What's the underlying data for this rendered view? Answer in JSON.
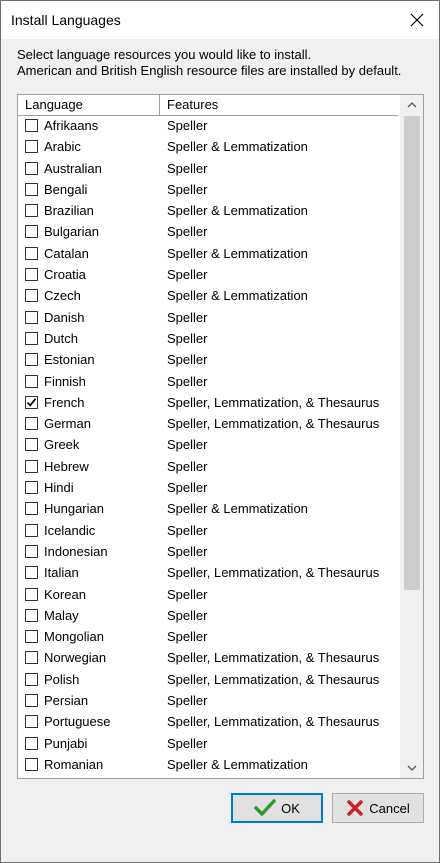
{
  "window": {
    "title": "Install Languages"
  },
  "intro": {
    "line1": "Select language resources you would like to install.",
    "line2": "American and British English resource files are installed by default."
  },
  "columns": [
    "Language",
    "Features"
  ],
  "rows": [
    {
      "language": "Afrikaans",
      "features": "Speller",
      "checked": false
    },
    {
      "language": "Arabic",
      "features": "Speller & Lemmatization",
      "checked": false
    },
    {
      "language": "Australian",
      "features": "Speller",
      "checked": false
    },
    {
      "language": "Bengali",
      "features": "Speller",
      "checked": false
    },
    {
      "language": "Brazilian",
      "features": "Speller & Lemmatization",
      "checked": false
    },
    {
      "language": "Bulgarian",
      "features": "Speller",
      "checked": false
    },
    {
      "language": "Catalan",
      "features": "Speller & Lemmatization",
      "checked": false
    },
    {
      "language": "Croatia",
      "features": "Speller",
      "checked": false
    },
    {
      "language": "Czech",
      "features": "Speller & Lemmatization",
      "checked": false
    },
    {
      "language": "Danish",
      "features": "Speller",
      "checked": false
    },
    {
      "language": "Dutch",
      "features": "Speller",
      "checked": false
    },
    {
      "language": "Estonian",
      "features": "Speller",
      "checked": false
    },
    {
      "language": "Finnish",
      "features": "Speller",
      "checked": false
    },
    {
      "language": "French",
      "features": "Speller, Lemmatization, & Thesaurus",
      "checked": true
    },
    {
      "language": "German",
      "features": "Speller, Lemmatization, & Thesaurus",
      "checked": false
    },
    {
      "language": "Greek",
      "features": "Speller",
      "checked": false
    },
    {
      "language": "Hebrew",
      "features": "Speller",
      "checked": false
    },
    {
      "language": "Hindi",
      "features": "Speller",
      "checked": false
    },
    {
      "language": "Hungarian",
      "features": "Speller & Lemmatization",
      "checked": false
    },
    {
      "language": "Icelandic",
      "features": "Speller",
      "checked": false
    },
    {
      "language": "Indonesian",
      "features": "Speller",
      "checked": false
    },
    {
      "language": "Italian",
      "features": "Speller, Lemmatization, & Thesaurus",
      "checked": false
    },
    {
      "language": "Korean",
      "features": "Speller",
      "checked": false
    },
    {
      "language": "Malay",
      "features": "Speller",
      "checked": false
    },
    {
      "language": "Mongolian",
      "features": "Speller",
      "checked": false
    },
    {
      "language": "Norwegian",
      "features": "Speller, Lemmatization, & Thesaurus",
      "checked": false
    },
    {
      "language": "Polish",
      "features": "Speller, Lemmatization, & Thesaurus",
      "checked": false
    },
    {
      "language": "Persian",
      "features": "Speller",
      "checked": false
    },
    {
      "language": "Portuguese",
      "features": "Speller, Lemmatization, & Thesaurus",
      "checked": false
    },
    {
      "language": "Punjabi",
      "features": "Speller",
      "checked": false
    },
    {
      "language": "Romanian",
      "features": "Speller & Lemmatization",
      "checked": false
    }
  ],
  "buttons": {
    "ok": "OK",
    "cancel": "Cancel"
  },
  "icons": {
    "close": "close-icon",
    "ok": "checkmark-icon",
    "cancel": "x-icon"
  },
  "colors": {
    "ok_check": "#2e9a2e",
    "cancel_x": "#c8232c",
    "focus_border": "#0078d7"
  }
}
